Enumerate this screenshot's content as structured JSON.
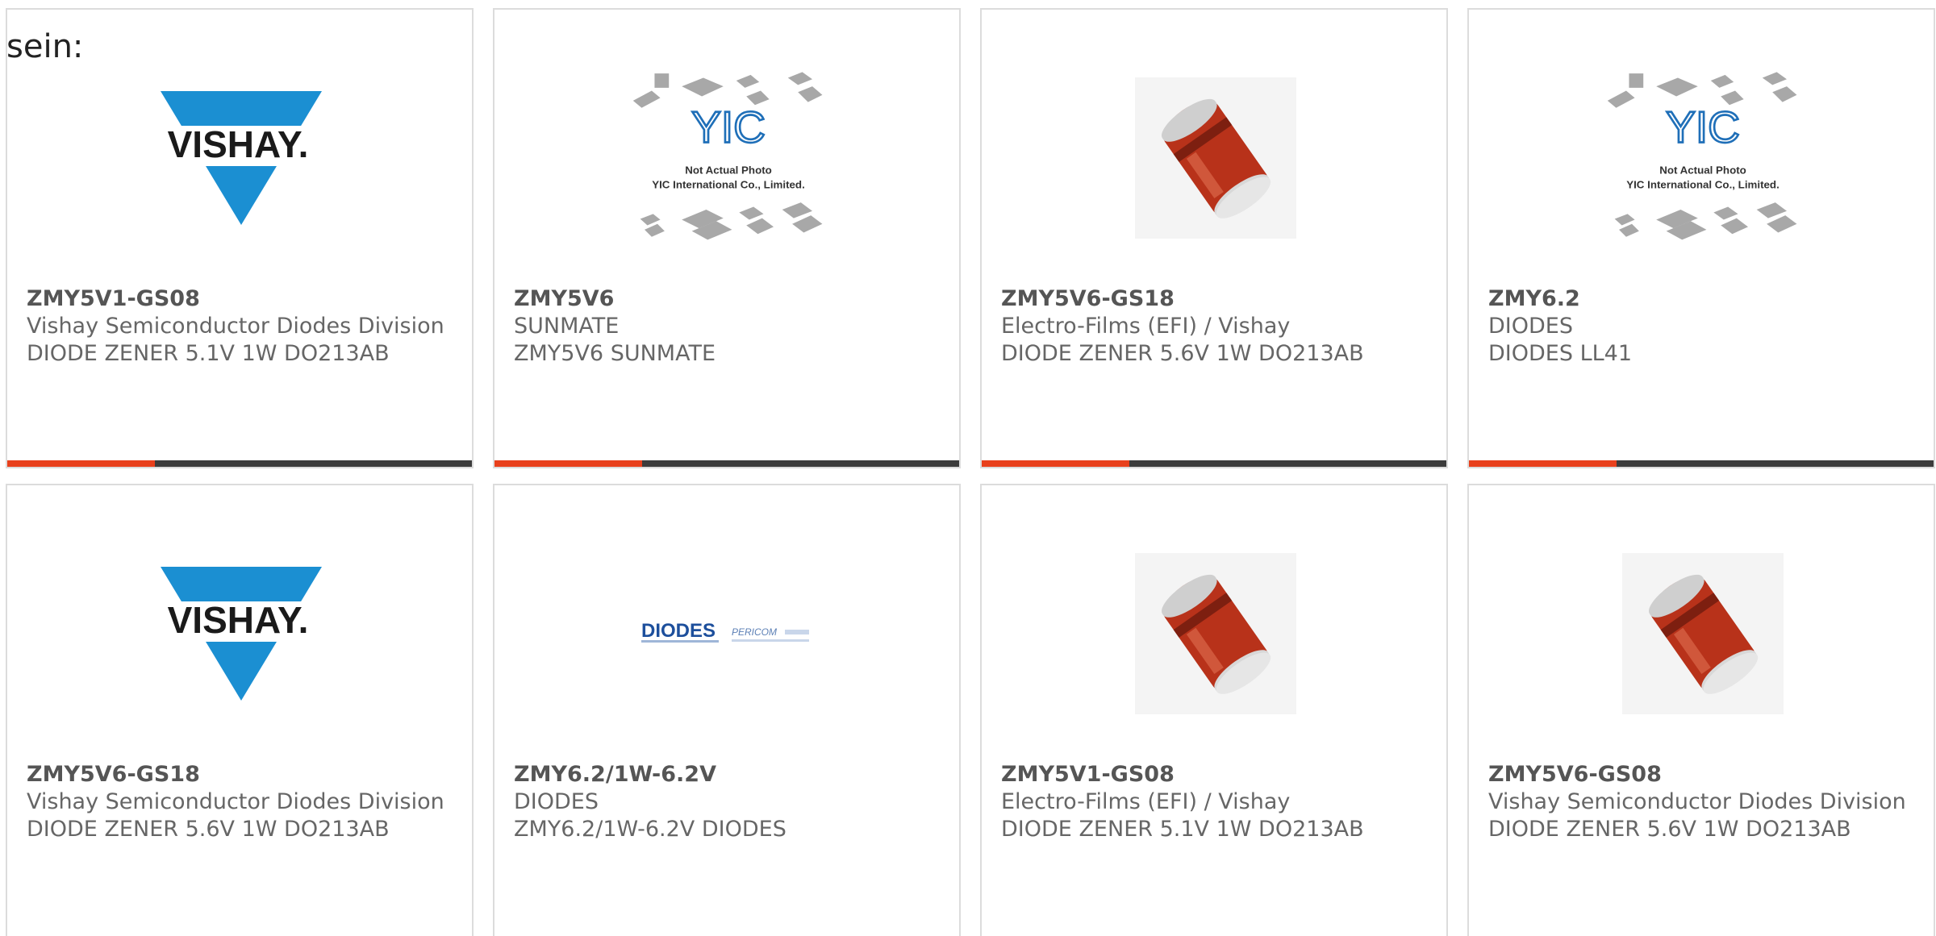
{
  "intro": "sein:",
  "colors": {
    "accent": "#e8401c",
    "bar": "#3c3c3c",
    "vishay_blue": "#1b8fd2",
    "diode_red": "#b8321a"
  },
  "cards": [
    {
      "part": "ZMY5V1-GS08",
      "manufacturer": "Vishay Semiconductor Diodes Division",
      "description": "DIODE ZENER 5.1V 1W DO213AB",
      "image": "vishay-logo"
    },
    {
      "part": "ZMY5V6",
      "manufacturer": "SUNMATE",
      "description": "ZMY5V6 SUNMATE",
      "image": "yic-placeholder",
      "image_text": {
        "logo": "YIC",
        "line1": "Not Actual Photo",
        "line2": "YIC International Co., Limited."
      }
    },
    {
      "part": "ZMY5V6-GS18",
      "manufacturer": "Electro-Films (EFI) / Vishay",
      "description": "DIODE ZENER 5.6V 1W DO213AB",
      "image": "melf-diode"
    },
    {
      "part": "ZMY6.2",
      "manufacturer": "DIODES",
      "description": "DIODES LL41",
      "image": "yic-placeholder",
      "image_text": {
        "logo": "YIC",
        "line1": "Not Actual Photo",
        "line2": "YIC International Co., Limited."
      }
    },
    {
      "part": "ZMY5V6-GS18",
      "manufacturer": "Vishay Semiconductor Diodes Division",
      "description": "DIODE ZENER 5.6V 1W DO213AB",
      "image": "vishay-logo"
    },
    {
      "part": "ZMY6.2/1W-6.2V",
      "manufacturer": "DIODES",
      "description": "ZMY6.2/1W-6.2V DIODES",
      "image": "diodes-pericom-logo",
      "image_text": {
        "brand1": "DIODES",
        "brand2": "PERICOM"
      }
    },
    {
      "part": "ZMY5V1-GS08",
      "manufacturer": "Electro-Films (EFI) / Vishay",
      "description": "DIODE ZENER 5.1V 1W DO213AB",
      "image": "melf-diode"
    },
    {
      "part": "ZMY5V6-GS08",
      "manufacturer": "Vishay Semiconductor Diodes Division",
      "description": "DIODE ZENER 5.6V 1W DO213AB",
      "image": "melf-diode"
    }
  ],
  "vishay_logo_text": "VISHAY."
}
